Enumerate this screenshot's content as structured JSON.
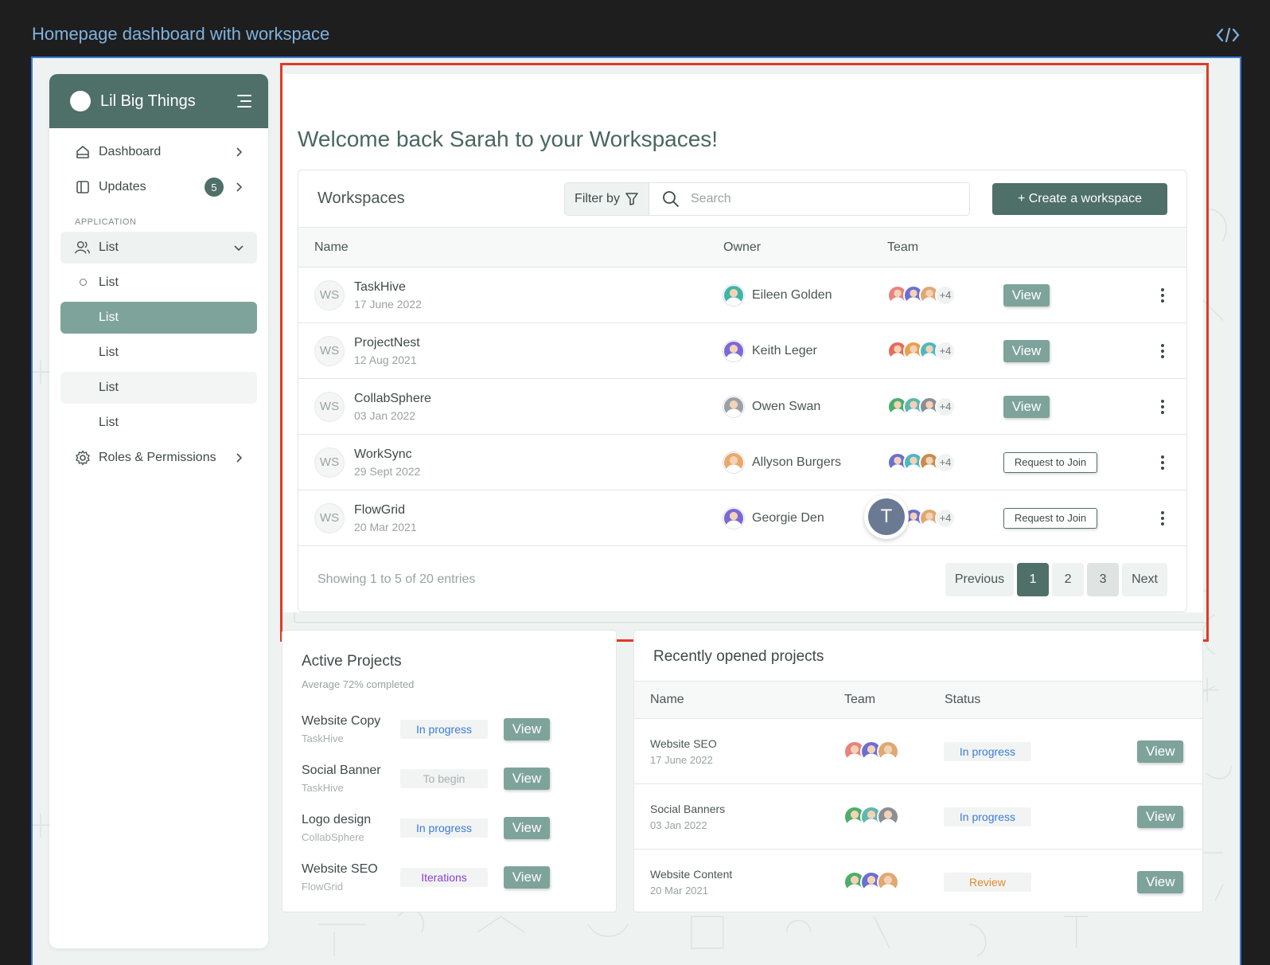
{
  "frame": {
    "title": "Homepage dashboard with workspace",
    "code_icon": "code-brackets-icon"
  },
  "sidebar": {
    "brand": "Lil Big Things",
    "items": [
      {
        "label": "Dashboard",
        "icon": "home-icon"
      },
      {
        "label": "Updates",
        "icon": "panel-icon",
        "badge": "5"
      }
    ],
    "section_label": "APPLICATION",
    "group": {
      "label": "List",
      "icon": "users-icon"
    },
    "sub_items": [
      "List",
      "List",
      "List",
      "List",
      "List"
    ],
    "roles": {
      "label": "Roles & Permissions",
      "icon": "gear-icon"
    }
  },
  "welcome": "Welcome back Sarah to your Workspaces!",
  "workspaces": {
    "title": "Workspaces",
    "filter_label": "Filter by",
    "search_placeholder": "Search",
    "create_label": "+ Create a workspace",
    "columns": {
      "name": "Name",
      "owner": "Owner",
      "team": "Team"
    },
    "rows": [
      {
        "badge": "WS",
        "name": "TaskHive",
        "date": "17 June 2022",
        "owner": "Eileen Golden",
        "owner_color": "#3fb5a8",
        "team": [
          "#e8837c",
          "#6b6fd1",
          "#e0a872"
        ],
        "more": "+4",
        "action": "View"
      },
      {
        "badge": "WS",
        "name": "ProjectNest",
        "date": "12 Aug 2021",
        "owner": "Keith Leger",
        "owner_color": "#7a6ad8",
        "team": [
          "#e36b5e",
          "#e7a04e",
          "#4cb8c4"
        ],
        "more": "+4",
        "action": "View"
      },
      {
        "badge": "WS",
        "name": "CollabSphere",
        "date": "03 Jan 2022",
        "owner": "Owen Swan",
        "owner_color": "#9aa0a6",
        "team": [
          "#4cae6a",
          "#5fb8b0",
          "#8a8f95"
        ],
        "more": "+4",
        "action": "View"
      },
      {
        "badge": "WS",
        "name": "WorkSync",
        "date": "29 Sept 2022",
        "owner": "Allyson Burgers",
        "owner_color": "#e9a96b",
        "team": [
          "#6b6fd1",
          "#4cb8c4",
          "#c98c4e"
        ],
        "more": "+4",
        "action": "Request to Join"
      },
      {
        "badge": "WS",
        "name": "FlowGrid",
        "date": "20 Mar 2021",
        "owner": "Georgie Den",
        "owner_color": "#7a6ad8",
        "team": [
          "#4cae6a",
          "#6b6fd1",
          "#e0a872"
        ],
        "more": "+4",
        "action": "Request to Join"
      }
    ],
    "cursor_avatar": "T",
    "showing": "Showing 1 to 5 of 20 entries",
    "pager": {
      "prev": "Previous",
      "pages": [
        "1",
        "2",
        "3"
      ],
      "next": "Next",
      "current": "1"
    }
  },
  "active_projects": {
    "title": "Active Projects",
    "subtitle": "Average 72% completed",
    "items": [
      {
        "name": "Website Copy",
        "project": "TaskHive",
        "status": "In progress",
        "status_color": "#3b7bd8",
        "action": "View"
      },
      {
        "name": "Social Banner",
        "project": "TaskHive",
        "status": "To begin",
        "status_color": "#a8b1af",
        "action": "View"
      },
      {
        "name": "Logo design",
        "project": "CollabSphere",
        "status": "In progress",
        "status_color": "#3b7bd8",
        "action": "View"
      },
      {
        "name": "Website SEO",
        "project": "FlowGrid",
        "status": "Iterations",
        "status_color": "#8a3fd1",
        "action": "View"
      }
    ]
  },
  "recent_projects": {
    "title": "Recently opened projects",
    "columns": {
      "name": "Name",
      "team": "Team",
      "status": "Status"
    },
    "rows": [
      {
        "name": "Website SEO",
        "date": "17 June 2022",
        "team": [
          "#e8837c",
          "#6b6fd1",
          "#e0a872"
        ],
        "status": "In progress",
        "status_color": "#3b7bd8",
        "action": "View"
      },
      {
        "name": "Social Banners",
        "date": "03 Jan 2022",
        "team": [
          "#4cae6a",
          "#5fb8b0",
          "#8a8f95"
        ],
        "status": "In progress",
        "status_color": "#3b7bd8",
        "action": "View"
      },
      {
        "name": "Website Content",
        "date": "20 Mar 2021",
        "team": [
          "#4cae6a",
          "#6b6fd1",
          "#e0a872"
        ],
        "status": "Review",
        "status_color": "#e08a2e",
        "action": "View"
      }
    ]
  }
}
